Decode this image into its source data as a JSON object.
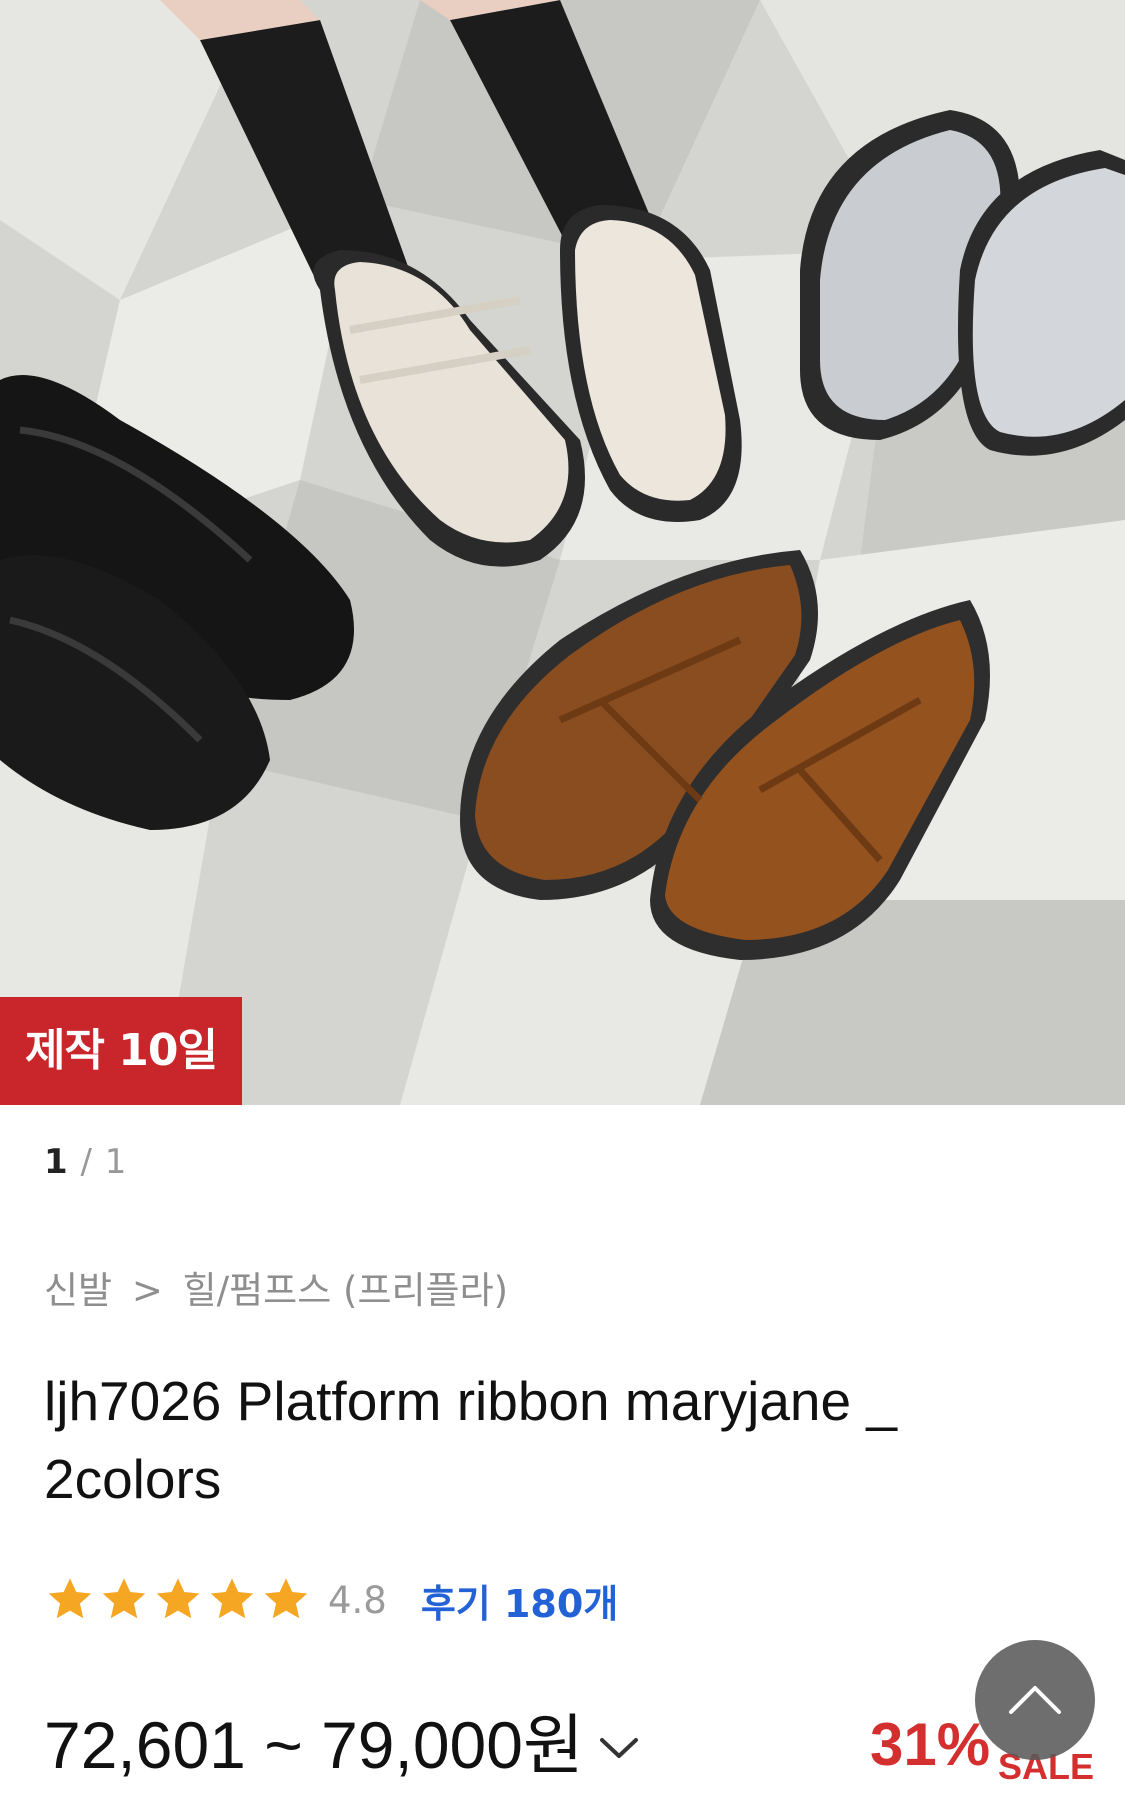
{
  "image": {
    "alt_icon": "product-photo",
    "badge": "제작 10일"
  },
  "gallery": {
    "current": "1",
    "separator": " / ",
    "total": "1"
  },
  "breadcrumb": {
    "category": "신발",
    "separator": ">",
    "subcategory": "힐/펌프스 (프리플라)"
  },
  "product": {
    "title": "ljh7026 Platform ribbon maryjane _ 2colors"
  },
  "rating": {
    "stars": 5,
    "score": "4.8",
    "reviews": "후기 180개"
  },
  "price": {
    "range": "72,601 ~ 79,000원",
    "discount": "31%",
    "sale_label": "SALE"
  },
  "colors": {
    "badge_bg": "#c8262b",
    "review_link": "#2361d6",
    "discount": "#d32f2f",
    "star": "#f5a623"
  }
}
